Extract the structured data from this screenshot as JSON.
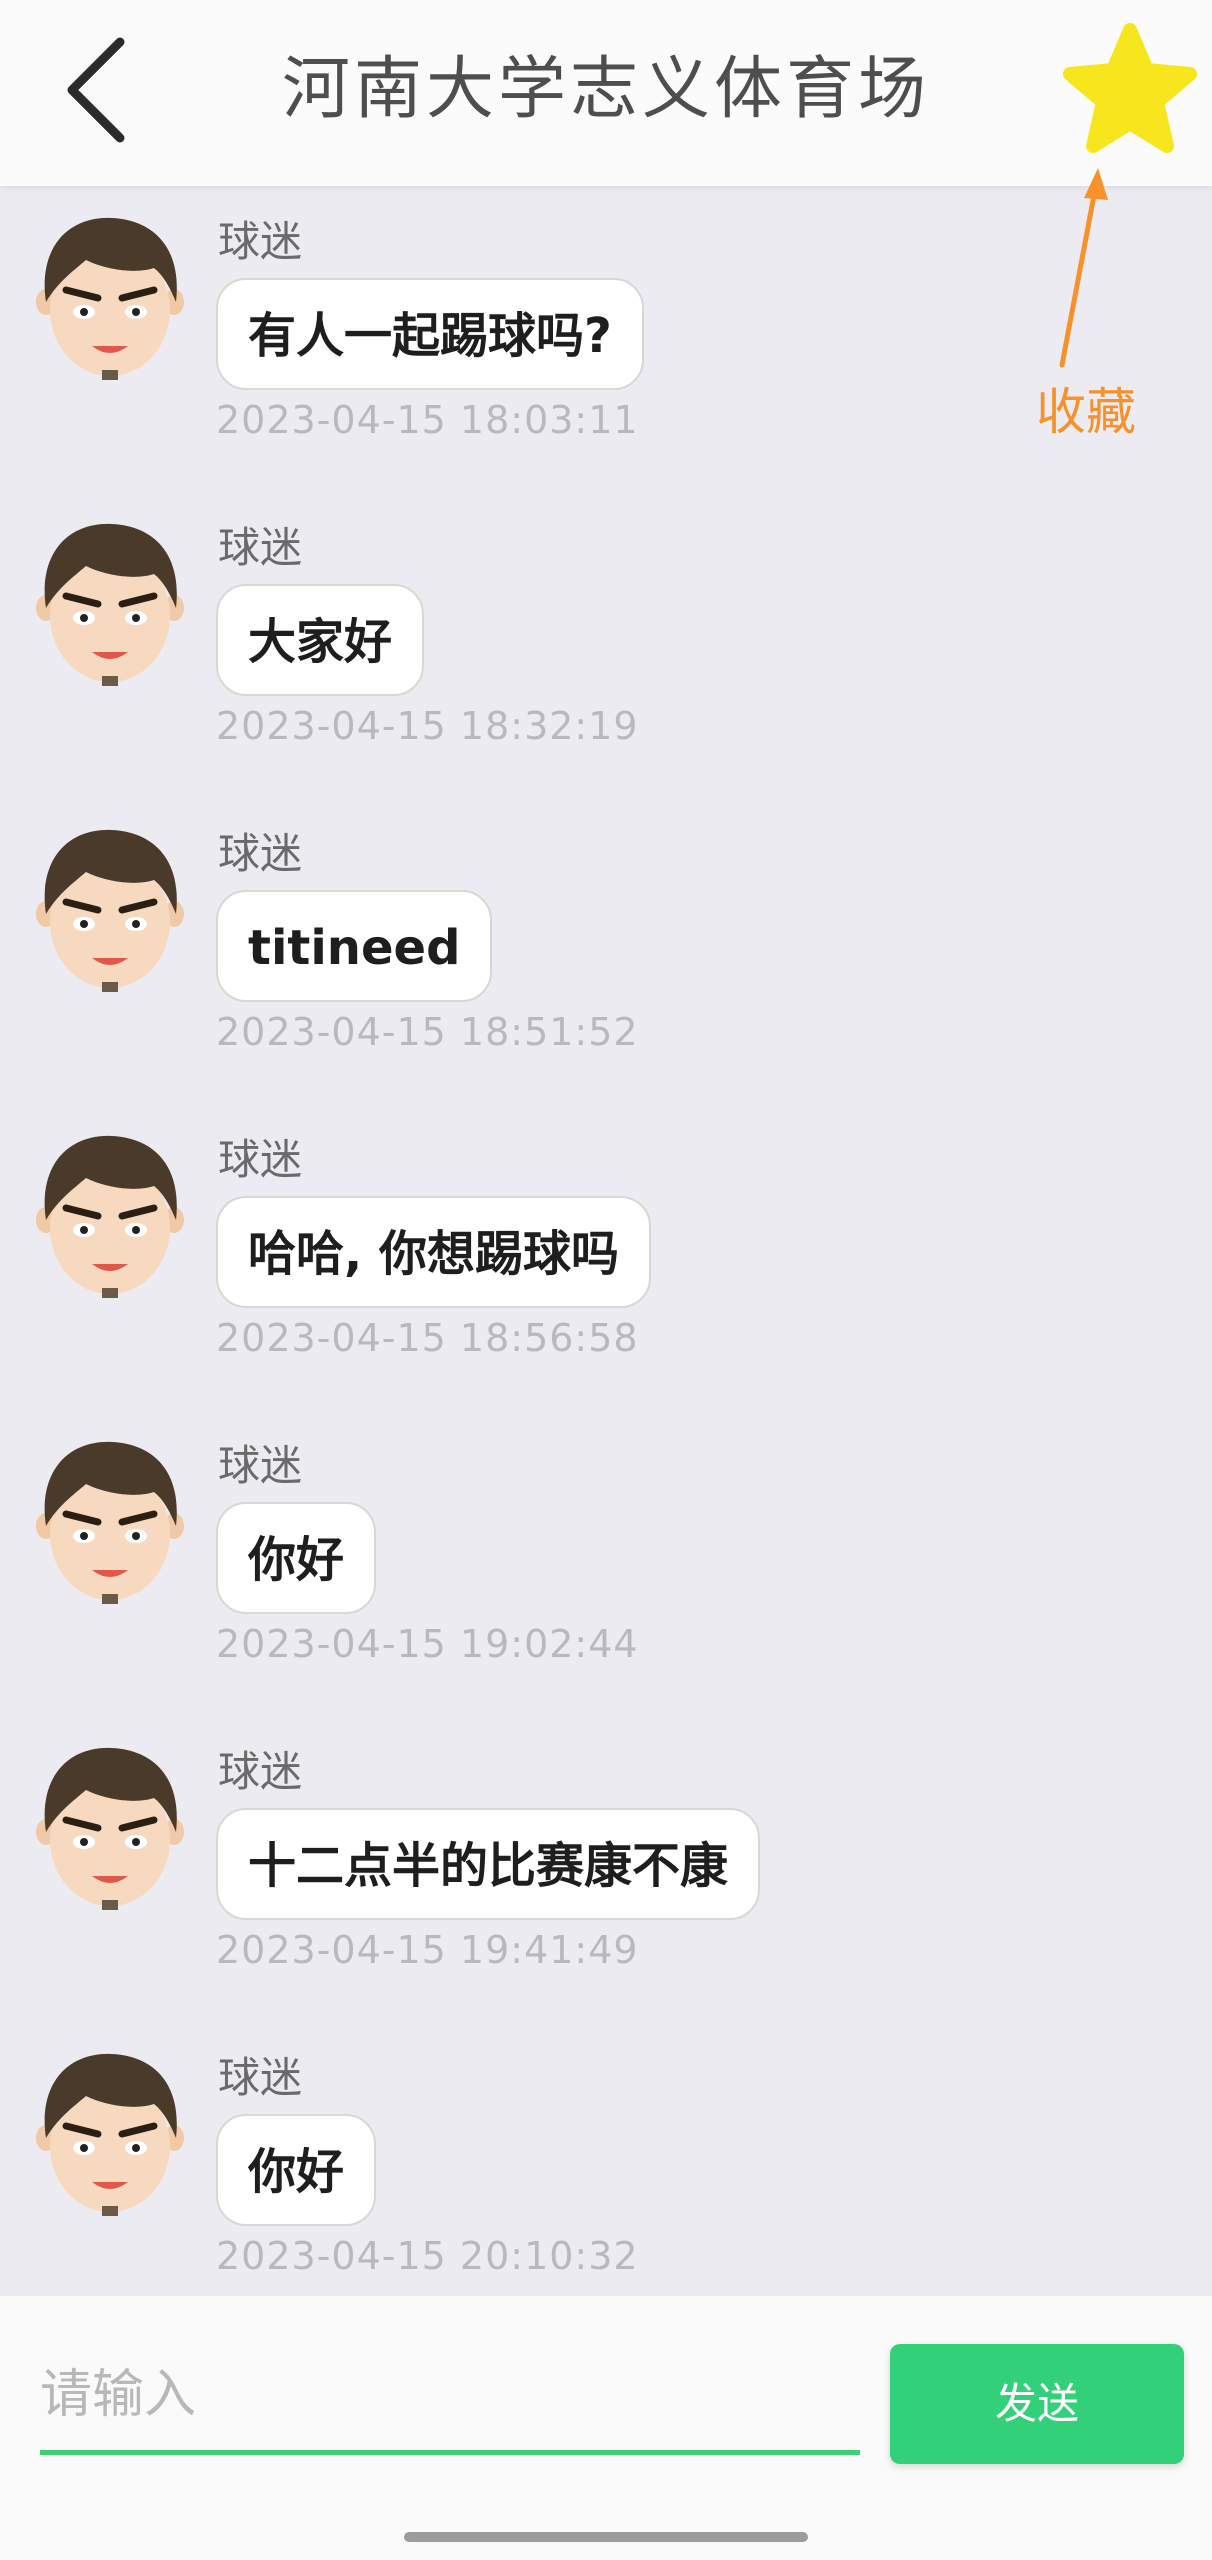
{
  "header": {
    "title": "河南大学志义体育场",
    "back_icon": "chevron-left-icon",
    "favorite_icon": "star-icon",
    "favorite_color": "#f7e51d"
  },
  "annotation": {
    "label": "收藏",
    "color": "#f7922b"
  },
  "messages": [
    {
      "user": "球迷",
      "text": "有人一起踢球吗?",
      "time": "2023-04-15 18:03:11"
    },
    {
      "user": "球迷",
      "text": "大家好",
      "time": "2023-04-15 18:32:19"
    },
    {
      "user": "球迷",
      "text": "titineed",
      "time": "2023-04-15 18:51:52"
    },
    {
      "user": "球迷",
      "text": "哈哈, 你想踢球吗",
      "time": "2023-04-15 18:56:58"
    },
    {
      "user": "球迷",
      "text": "你好",
      "time": "2023-04-15 19:02:44"
    },
    {
      "user": "球迷",
      "text": "十二点半的比赛康不康",
      "time": "2023-04-15 19:41:49"
    },
    {
      "user": "球迷",
      "text": "你好",
      "time": "2023-04-15 20:10:32"
    }
  ],
  "input": {
    "placeholder": "请输入",
    "value": ""
  },
  "send_button": {
    "label": "发送",
    "color": "#33d07a"
  }
}
